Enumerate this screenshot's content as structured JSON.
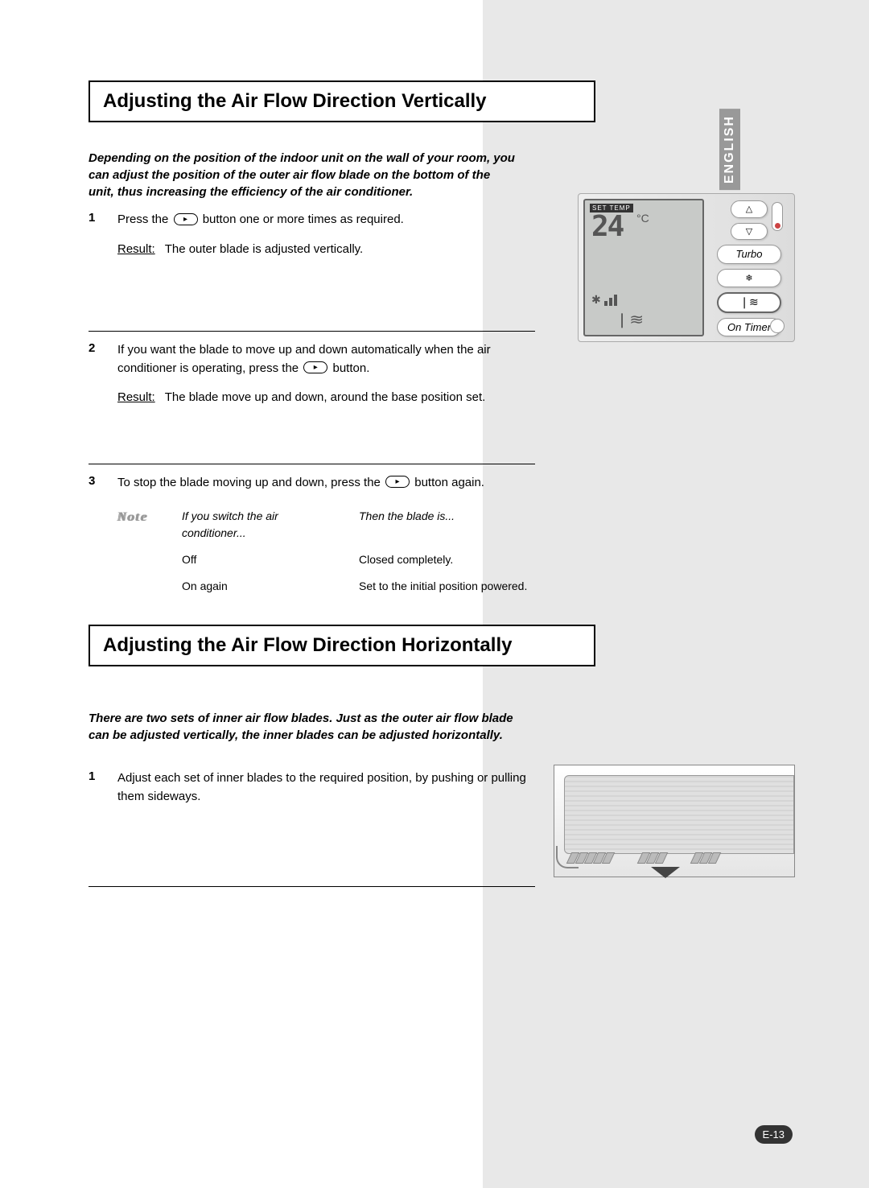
{
  "language_tab": "ENGLISH",
  "page_number": "E-13",
  "section1": {
    "title": "Adjusting the Air Flow Direction Vertically",
    "intro": "Depending on the position of the indoor unit on the wall of your room, you can adjust the position of the outer air flow blade on the bottom of the unit, thus increasing the efficiency of the air conditioner.",
    "steps": [
      {
        "num": "1",
        "text_a": "Press the ",
        "text_b": " button one or more times as required.",
        "result_label": "Result:",
        "result_text": "The outer blade is adjusted vertically."
      },
      {
        "num": "2",
        "text_a": "If you want the blade to move up and down automatically when the air conditioner is operating, press the ",
        "text_b": " button.",
        "result_label": "Result:",
        "result_text": "The blade move up and down, around the base position set."
      },
      {
        "num": "3",
        "text_a": "To stop the blade moving up and down, press the ",
        "text_b": " button again.",
        "note_label": "Note",
        "note_header": {
          "c1": "If you switch the air conditioner...",
          "c2": "Then the blade is..."
        },
        "note_rows": [
          {
            "c1": "Off",
            "c2": "Closed completely."
          },
          {
            "c1": "On again",
            "c2": "Set to the initial position powered."
          }
        ]
      }
    ]
  },
  "section2": {
    "title": "Adjusting the Air Flow Direction Horizontally",
    "intro": "There are two sets of inner air flow blades. Just as the outer air flow blade can be adjusted vertically, the inner blades can be adjusted horizontally.",
    "steps": [
      {
        "num": "1",
        "text": "Adjust each set of inner blades to the required position, by pushing or pulling them sideways."
      }
    ]
  },
  "remote": {
    "set_temp_label": "SET TEMP",
    "temp_value": "24",
    "temp_unit": "°C",
    "turbo": "Turbo",
    "on_timer": "On Timer",
    "swing_glyph": "❘≋",
    "up_glyph": "△",
    "down_glyph": "▽",
    "sun_glyph": "❄"
  }
}
